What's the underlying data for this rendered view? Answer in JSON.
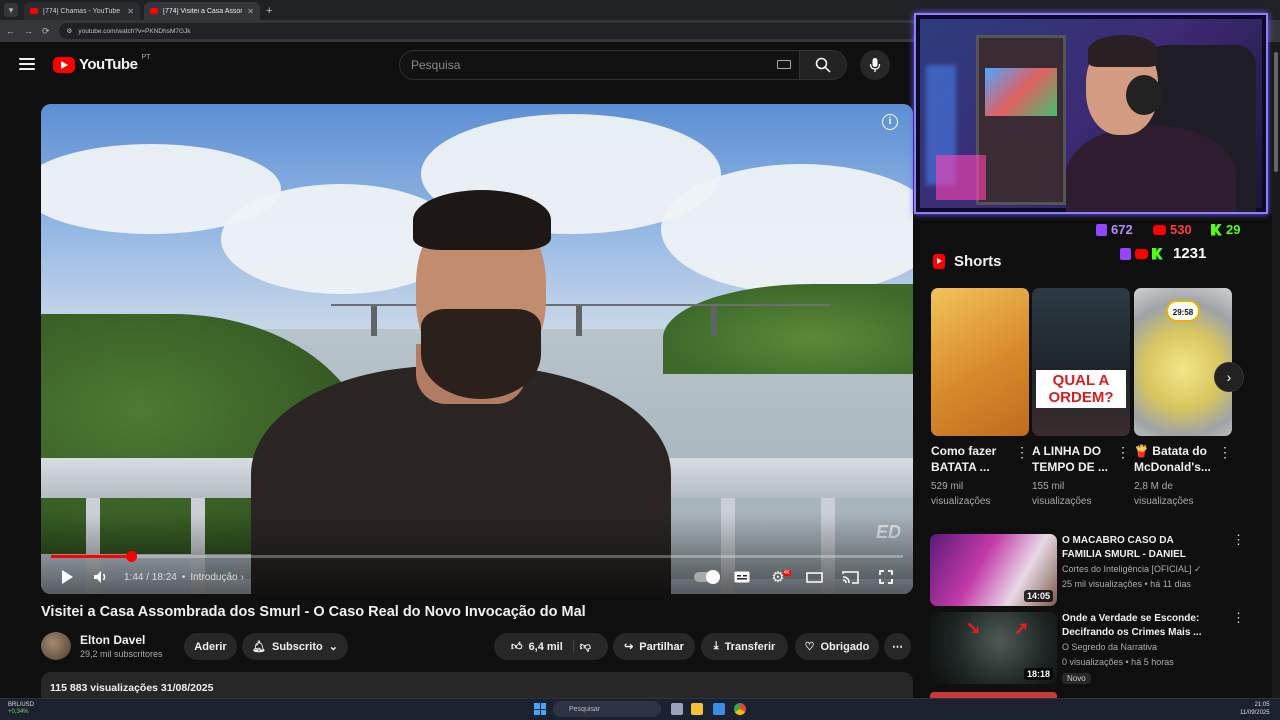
{
  "browser": {
    "tabs": [
      {
        "label": "[774] Chamas - YouTube",
        "active": false
      },
      {
        "label": "[774] Visitei a Casa Assombrad...",
        "active": true
      }
    ],
    "url": "youtube.com/watch?v=PKNDhsM7GJk"
  },
  "header": {
    "logo_text": "YouTube",
    "logo_region": "PT",
    "search_placeholder": "Pesquisa"
  },
  "player": {
    "time": "1:44 / 18:24",
    "chapter": "Introdução",
    "progress": 0.094,
    "watermark": "ED"
  },
  "video": {
    "title": "Visitei a Casa Assombrada dos Smurl - O Caso Real do Novo Invocação do Mal",
    "channel": "Elton Davel",
    "subscribers": "29,2 mil subscritores",
    "join_label": "Aderir",
    "subscribed_label": "Subscrito",
    "likes": "6,4 mil",
    "share_label": "Partilhar",
    "download_label": "Transferir",
    "thanks_label": "Obrigado",
    "views_date": "115 883 visualizações  31/08/2025"
  },
  "stream_stats": {
    "twitch": "672",
    "youtube": "530",
    "kick": "29",
    "total": "1231"
  },
  "shorts": {
    "heading": "Shorts",
    "items": [
      {
        "title": "Como fazer BATATA ...",
        "views": "529 mil visualizações",
        "thumb_text": ""
      },
      {
        "title": "A LINHA DO TEMPO DE ...",
        "views": "155 mil visualizações",
        "thumb_text": "QUAL A ORDEM?"
      },
      {
        "title": "🍟 Batata do McDonald's...",
        "views": "2,8 M de visualizações",
        "thumb_text": "29:58"
      }
    ]
  },
  "recommendations": [
    {
      "title": "O MACABRO CASO DA FAMILIA SMURL - DANIEL PIRES E ...",
      "channel": "Cortes do Inteligência [OFICIAL] ✓",
      "meta": "25 mil visualizações • há 11 dias",
      "duration": "14:05",
      "badge": ""
    },
    {
      "title": "Onde a Verdade se Esconde: Decifrando os Crimes Mais ...",
      "channel": "O Segredo da Narrativa",
      "meta": "0 visualizações • há 5 horas",
      "duration": "18:18",
      "badge": "Novo"
    }
  ],
  "taskbar": {
    "search_placeholder": "Pesquisar",
    "weather": "BRL/USD",
    "weather_change": "+0,34%",
    "time": "21:05",
    "date": "11/09/2025"
  },
  "colors": {
    "youtube_red": "#ff0000",
    "twitch": "#9146ff",
    "kick": "#53fc18",
    "background": "#0f0f0f"
  }
}
